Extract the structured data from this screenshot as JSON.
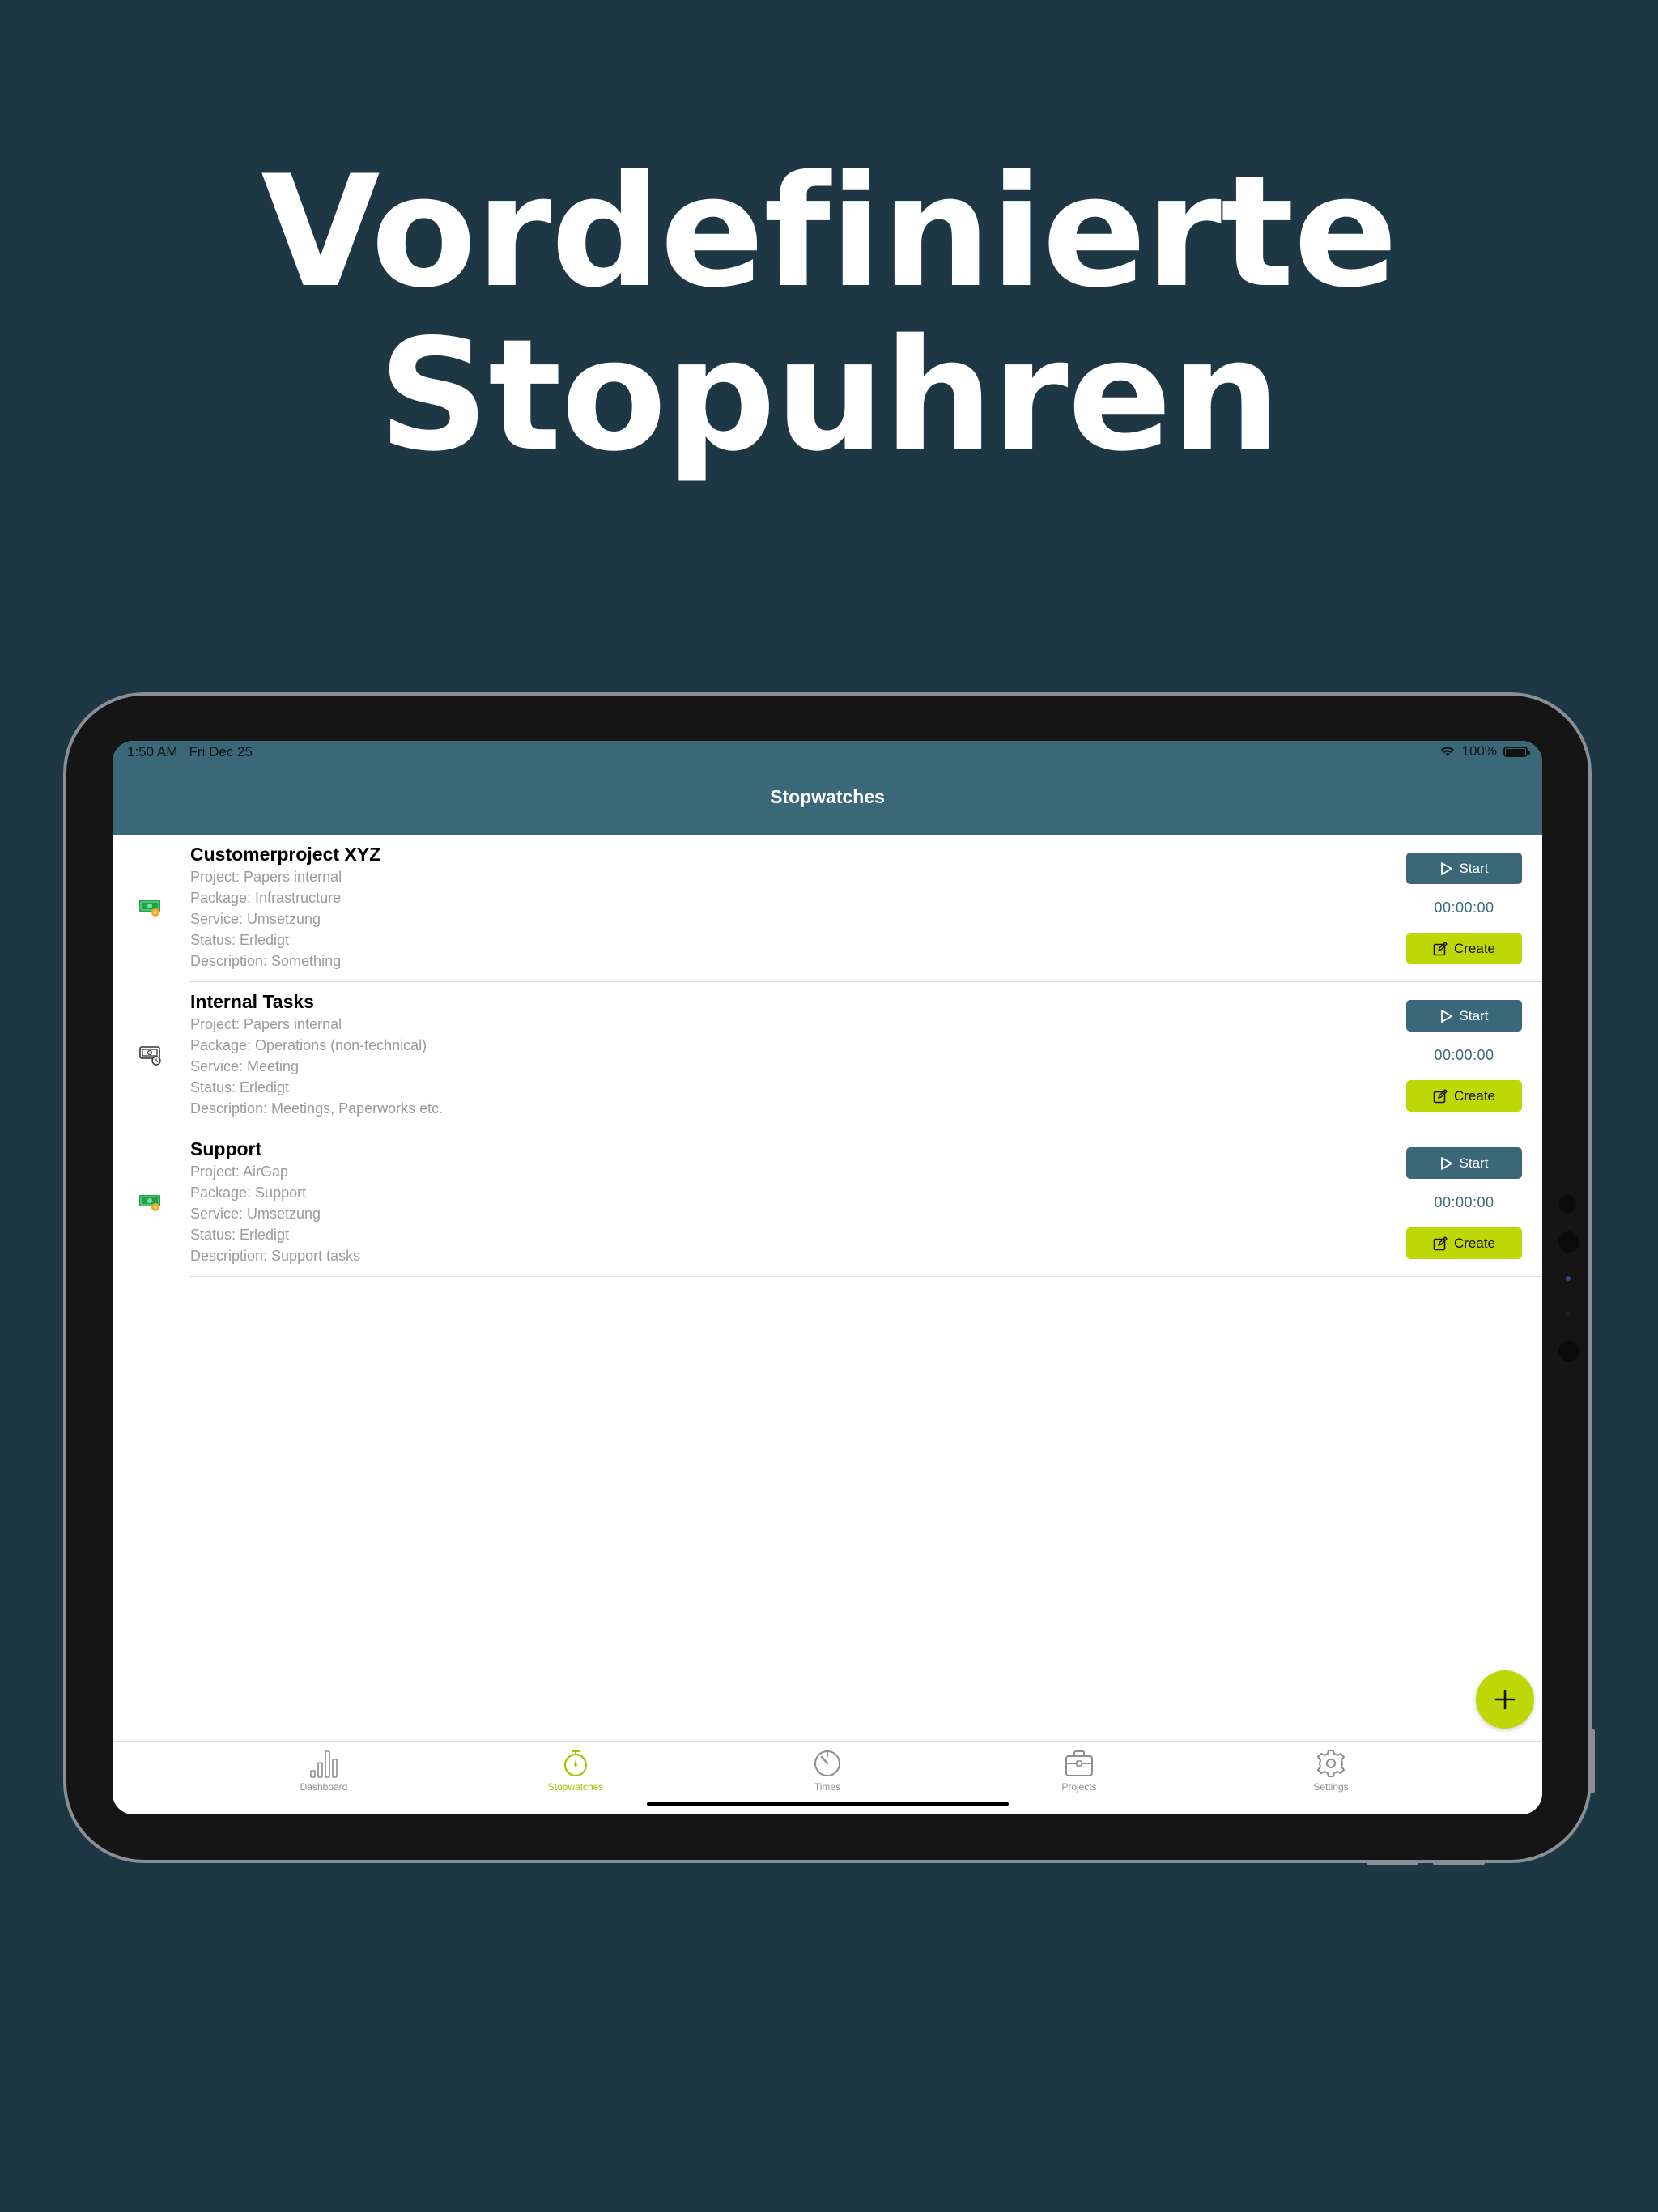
{
  "headline": {
    "line1": "Vordefinierte",
    "line2": "Stopuhren"
  },
  "status_bar": {
    "time": "1:50 AM",
    "date": "Fri Dec 25",
    "battery": "100%"
  },
  "navbar": {
    "title": "Stopwatches"
  },
  "stopwatches": [
    {
      "title": "Customerproject XYZ",
      "icon": "money-icon",
      "project": "Project: Papers internal",
      "package": "Package: Infrastructure",
      "service": "Service: Umsetzung",
      "status": "Status: Erledigt",
      "description": "Description: Something",
      "start_label": "Start",
      "timer": "00:00:00",
      "create_label": "Create"
    },
    {
      "title": "Internal Tasks",
      "icon": "internal-tasks-icon",
      "project": "Project: Papers internal",
      "package": "Package: Operations (non-technical)",
      "service": "Service: Meeting",
      "status": "Status: Erledigt",
      "description": "Description: Meetings, Paperworks etc.",
      "start_label": "Start",
      "timer": "00:00:00",
      "create_label": "Create"
    },
    {
      "title": "Support",
      "icon": "money-icon",
      "project": "Project: AirGap",
      "package": "Package: Support",
      "service": "Service: Umsetzung",
      "status": "Status: Erledigt",
      "description": "Description: Support tasks",
      "start_label": "Start",
      "timer": "00:00:00",
      "create_label": "Create"
    }
  ],
  "tabs": [
    {
      "label": "Dashboard",
      "icon": "bar-chart-icon",
      "active": false
    },
    {
      "label": "Stopwatches",
      "icon": "stopwatch-icon",
      "active": true
    },
    {
      "label": "Times",
      "icon": "timer-icon",
      "active": false
    },
    {
      "label": "Projects",
      "icon": "briefcase-icon",
      "active": false
    },
    {
      "label": "Settings",
      "icon": "gear-icon",
      "active": false
    }
  ],
  "colors": {
    "background": "#1e3744",
    "header": "#3a6878",
    "accent": "#bdd806",
    "active_tab": "#a4c400"
  }
}
